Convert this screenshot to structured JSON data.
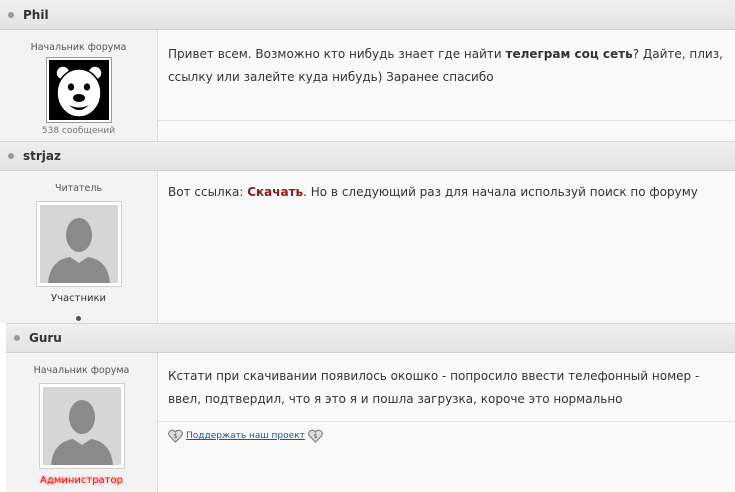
{
  "posts": [
    {
      "author": "Phil",
      "rank": "Начальник форума",
      "post_count": "538 сообщений",
      "avatar": "bear-avatar",
      "text_before": "Привет всем. Возможно кто нибудь знает где найти ",
      "text_bold": "телеграм соц сеть",
      "text_after": "? Дайте, плиз, ссылку или залейте куда нибудь) Заранее спасибо"
    },
    {
      "author": "strjaz",
      "rank": "Читатель",
      "group": "Участники",
      "avatar": "default-silhouette",
      "text_before": "Вот ссылка: ",
      "link_label": "Скачать",
      "text_after": ". Но в следующий раз для начала используй поиск по форуму"
    },
    {
      "author": "Guru",
      "rank": "Начальник форума",
      "group": "Администратор",
      "avatar": "default-silhouette",
      "text": "Кстати при скачивании появилось окошко - попросило ввести телефонный номер - ввел, подтвердил, что я это я и пошла загрузка, короче это нормально",
      "support_link": "Поддержать наш проект"
    }
  ],
  "colors": {
    "link": "#8b1a1a",
    "admin": "#ff0000",
    "support_link": "#1a55a8"
  }
}
